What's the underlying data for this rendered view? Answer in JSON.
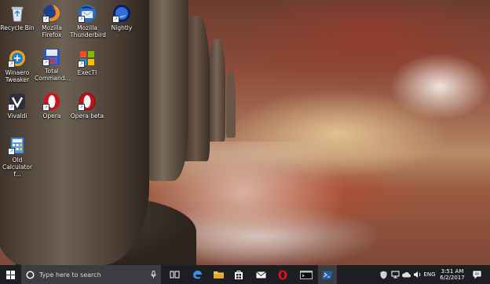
{
  "desktop": {
    "icons": [
      {
        "label": "Recycle Bin",
        "icon": "recycle-bin-icon"
      },
      {
        "label": "Mozilla Firefox",
        "icon": "firefox-icon"
      },
      {
        "label": "Mozilla Thunderbird",
        "icon": "thunderbird-icon"
      },
      {
        "label": "Nightly",
        "icon": "nightly-icon"
      },
      {
        "label": "Winaero Tweaker",
        "icon": "winaero-tweaker-icon"
      },
      {
        "label": "Total Command...",
        "icon": "total-commander-icon"
      },
      {
        "label": "ExecTI",
        "icon": "execti-icon"
      },
      {
        "label": "Vivaldi",
        "icon": "vivaldi-icon"
      },
      {
        "label": "Opera",
        "icon": "opera-icon"
      },
      {
        "label": "Opera beta",
        "icon": "opera-beta-icon"
      },
      {
        "label": "Old Calculator f...",
        "icon": "calculator-icon"
      }
    ]
  },
  "taskbar": {
    "search_placeholder": "Type here to search",
    "pinned": [
      "task-view-icon",
      "edge-icon",
      "file-explorer-icon",
      "store-icon",
      "mail-icon",
      "opera-icon",
      "terminal-icon",
      "powershell-icon"
    ],
    "tray": {
      "language": "ENG",
      "time": "3:51 AM",
      "date": "6/2/2017"
    }
  },
  "colors": {
    "taskbar": "#1c1e22",
    "search_box": "#3b3d40",
    "accent": "#0078d7"
  }
}
